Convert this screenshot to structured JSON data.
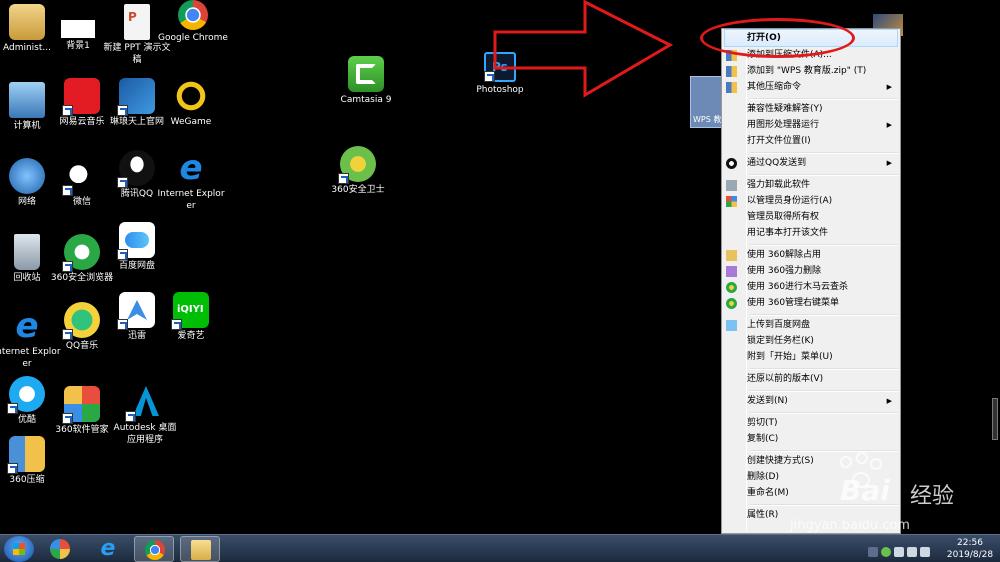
{
  "desktop_icons": [
    {
      "id": "admin",
      "label": "Administ...",
      "icon": "user-folder-icon",
      "color": "#d8b35a"
    },
    {
      "id": "bg1",
      "label": "背景1",
      "icon": "image-file-icon",
      "color": "#ffffff"
    },
    {
      "id": "ppt",
      "label": "新建 PPT 演示文稿",
      "icon": "ppt-file-icon",
      "color": "#e8e8e8"
    },
    {
      "id": "chrome",
      "label": "Google Chrome",
      "icon": "chrome-icon",
      "color": "#4285f4"
    },
    {
      "id": "computer",
      "label": "计算机",
      "icon": "computer-icon",
      "color": "#6aa7d8"
    },
    {
      "id": "netease",
      "label": "网易云音乐",
      "icon": "netease-music-icon",
      "color": "#e31c23"
    },
    {
      "id": "tiangu",
      "label": "琳琅天上官网",
      "icon": "tianshang-icon",
      "color": "#1b5aa5"
    },
    {
      "id": "wegame",
      "label": "WeGame",
      "icon": "wegame-icon",
      "color": "#f0c419"
    },
    {
      "id": "network",
      "label": "网络",
      "icon": "network-icon",
      "color": "#3c8ad8"
    },
    {
      "id": "wechat",
      "label": "微信",
      "icon": "wechat-icon",
      "color": "#2dc100"
    },
    {
      "id": "qq",
      "label": "腾讯QQ",
      "icon": "qq-icon",
      "color": "#222222"
    },
    {
      "id": "ie1",
      "label": "Internet Explorer",
      "icon": "ie-icon",
      "color": "#1e88e5"
    },
    {
      "id": "recycle",
      "label": "回收站",
      "icon": "recycle-bin-icon",
      "color": "#9aa8b5"
    },
    {
      "id": "360browser",
      "label": "360安全浏览器",
      "icon": "360-browser-icon",
      "color": "#2aa845"
    },
    {
      "id": "baidupan",
      "label": "百度网盘",
      "icon": "baidu-netdisk-icon",
      "color": "#2f8ff0"
    },
    {
      "id": "ie2",
      "label": "Internet Explorer",
      "icon": "ie-icon",
      "color": "#1e88e5"
    },
    {
      "id": "qqmusic",
      "label": "QQ音乐",
      "icon": "qq-music-icon",
      "color": "#31c27c"
    },
    {
      "id": "xunlei",
      "label": "迅雷",
      "icon": "xunlei-icon",
      "color": "#3a8ee6"
    },
    {
      "id": "iqiyi",
      "label": "爱奇艺",
      "icon": "iqiyi-icon",
      "color": "#00be06"
    },
    {
      "id": "youku",
      "label": "优酷",
      "icon": "youku-icon",
      "color": "#1eaaf1"
    },
    {
      "id": "360mgr",
      "label": "360软件管家",
      "icon": "360-software-icon",
      "color": "#e94e3c"
    },
    {
      "id": "autodesk",
      "label": "Autodesk 桌面应用程序",
      "icon": "autodesk-icon",
      "color": "#0696d7"
    },
    {
      "id": "360zip",
      "label": "360压缩",
      "icon": "360-zip-icon",
      "color": "#4a90d9"
    },
    {
      "id": "camtasia",
      "label": "Camtasia 9",
      "icon": "camtasia-icon",
      "color": "#3cae35"
    },
    {
      "id": "photoshop",
      "label": "Photoshop",
      "icon": "photoshop-icon",
      "color": "#0b1a2e"
    },
    {
      "id": "360safe",
      "label": "360安全卫士",
      "icon": "360-safe-icon",
      "color": "#6bc04b"
    }
  ],
  "selected_file": {
    "label": "WPS 教"
  },
  "context_menu": {
    "items": [
      {
        "label": "打开(O)",
        "bold": true,
        "highlight": true
      },
      {
        "label": "添加到压缩文件(A)...",
        "icon": "zip-icon"
      },
      {
        "label": "添加到 \"WPS 教育版.zip\" (T)",
        "icon": "zip-icon"
      },
      {
        "label": "其他压缩命令",
        "icon": "zip-icon",
        "submenu": true
      },
      {
        "sep": true
      },
      {
        "label": "兼容性疑难解答(Y)"
      },
      {
        "label": "用图形处理器运行",
        "submenu": true
      },
      {
        "label": "打开文件位置(I)"
      },
      {
        "sep": true
      },
      {
        "label": "通过QQ发送到",
        "icon": "qq-small-icon",
        "submenu": true
      },
      {
        "sep": true
      },
      {
        "label": "强力卸载此软件",
        "icon": "uninstall-icon"
      },
      {
        "label": "以管理员身份运行(A)",
        "icon": "shield-icon"
      },
      {
        "label": "管理员取得所有权"
      },
      {
        "label": "用记事本打开该文件"
      },
      {
        "sep": true
      },
      {
        "label": "使用 360解除占用",
        "icon": "folder-lock-icon"
      },
      {
        "label": "使用 360强力删除",
        "icon": "delete-icon"
      },
      {
        "label": "使用 360进行木马云查杀",
        "icon": "360-scan-icon"
      },
      {
        "label": "使用 360管理右键菜单",
        "icon": "360-scan-icon"
      },
      {
        "sep": true
      },
      {
        "label": "上传到百度网盘",
        "icon": "baidu-cloud-icon"
      },
      {
        "label": "锁定到任务栏(K)"
      },
      {
        "label": "附到「开始」菜单(U)"
      },
      {
        "sep": true
      },
      {
        "label": "还原以前的版本(V)"
      },
      {
        "sep": true
      },
      {
        "label": "发送到(N)",
        "submenu": true
      },
      {
        "sep": true
      },
      {
        "label": "剪切(T)"
      },
      {
        "label": "复制(C)"
      },
      {
        "sep": true
      },
      {
        "label": "创建快捷方式(S)"
      },
      {
        "label": "删除(D)"
      },
      {
        "label": "重命名(M)"
      },
      {
        "sep": true
      },
      {
        "label": "属性(R)"
      }
    ]
  },
  "taskbar": {
    "clock_time": "22:56",
    "clock_date": "2019/8/28"
  },
  "watermark": {
    "logo": "Bai",
    "text": "经验",
    "url": "jingyan.baidu.com"
  }
}
